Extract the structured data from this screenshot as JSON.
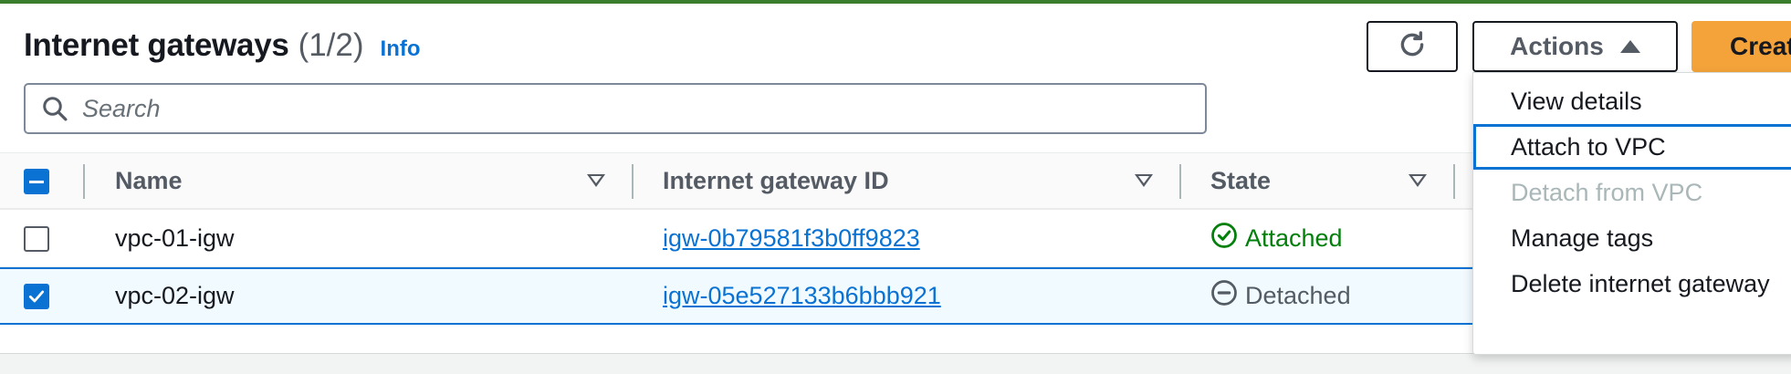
{
  "header": {
    "title": "Internet gateways",
    "count": "(1/2)",
    "info_link": "Info"
  },
  "search": {
    "placeholder": "Search",
    "value": ""
  },
  "toolbar": {
    "actions_label": "Actions",
    "create_label": "Creat"
  },
  "table": {
    "columns": [
      "Name",
      "Internet gateway ID",
      "State"
    ],
    "rows": [
      {
        "name": "vpc-01-igw",
        "id": "igw-0b79581f3b0ff9823",
        "state": "Attached",
        "selected": false
      },
      {
        "name": "vpc-02-igw",
        "id": "igw-05e527133b6bbb921",
        "state": "Detached",
        "selected": true
      }
    ]
  },
  "actions_menu": {
    "items": [
      {
        "label": "View details",
        "state": "enabled"
      },
      {
        "label": "Attach to VPC",
        "state": "focused"
      },
      {
        "label": "Detach from VPC",
        "state": "disabled"
      },
      {
        "label": "Manage tags",
        "state": "enabled"
      },
      {
        "label": "Delete internet gateway",
        "state": "enabled"
      }
    ]
  },
  "colors": {
    "accent": "#0972d3",
    "create_button": "#f3a33a",
    "attached": "#037f0c",
    "detached": "#545b64",
    "top_bar": "#3a7d2c"
  },
  "icons": {
    "search": "search-icon",
    "refresh": "refresh-icon",
    "actions_caret": "caret-up-icon",
    "attached": "check-circle-icon",
    "detached": "minus-circle-icon"
  }
}
